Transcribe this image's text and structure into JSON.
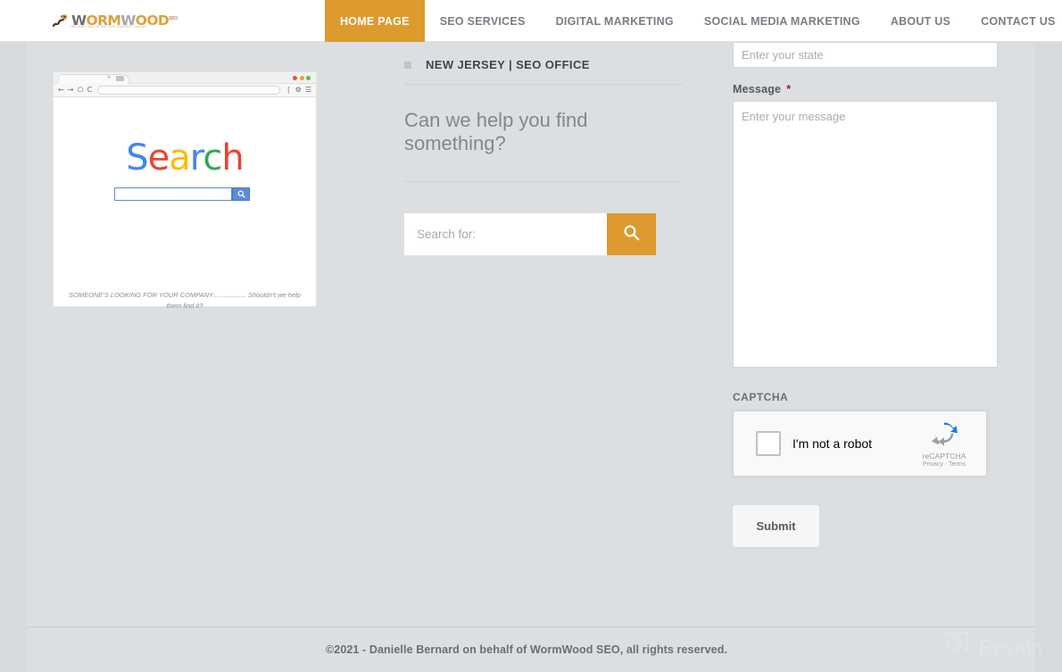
{
  "header": {
    "logo": {
      "name": "WormWood",
      "part1": "W",
      "part2": "ORM",
      "part3": "W",
      "part4": "OOD",
      "superscript": "SEO",
      "tagline": "HELPING YOU BEING DISCOVERED ONLINE",
      "icon": "worm-logo-icon"
    },
    "nav": [
      {
        "label": "HOME PAGE",
        "active": true
      },
      {
        "label": "SEO SERVICES",
        "active": false
      },
      {
        "label": "DIGITAL MARKETING",
        "active": false
      },
      {
        "label": "SOCIAL MEDIA MARKETING",
        "active": false
      },
      {
        "label": "ABOUT US",
        "active": false
      },
      {
        "label": "CONTACT US",
        "active": false
      }
    ],
    "search_icon": "search-icon",
    "active_color": "#dd9a2f",
    "search_button_color": "#1e2c4a"
  },
  "illustration": {
    "browser": {
      "tab_close": "x",
      "url_value": "",
      "back_icon": "arrow-left-icon",
      "forward_icon": "arrow-right-icon",
      "home_icon": "home-icon",
      "reload_icon": "reload-icon",
      "bookmark_icon": "bookmark-icon",
      "settings_icon": "gear-icon",
      "menu_icon": "hamburger-menu-icon",
      "dots": [
        "red",
        "orange",
        "green"
      ]
    },
    "search_word": {
      "letters": [
        "S",
        "e",
        "a",
        "r",
        "c",
        "h"
      ],
      "colors": [
        "#4285f4",
        "#ea4335",
        "#fbbc05",
        "#4285f4",
        "#34a853",
        "#ea4335"
      ]
    },
    "mini_search_icon": "search-icon",
    "caption": "SOMEONE'S LOOKING FOR YOUR COMPANY.................. Shouldn't we help them find it?"
  },
  "middle": {
    "section_title": "NEW JERSEY | SEO OFFICE",
    "heading": "Can we help you find something?",
    "search": {
      "placeholder": "Search for:",
      "value": "",
      "button_icon": "search-icon",
      "button_color": "#dd9a2f"
    }
  },
  "form": {
    "state": {
      "placeholder": "Enter your state",
      "value": ""
    },
    "message": {
      "label": "Message",
      "required_mark": "*",
      "placeholder": "Enter your message",
      "value": ""
    },
    "captcha": {
      "label": "CAPTCHA",
      "checkbox_label": "I'm not a robot",
      "brand": "reCAPTCHA",
      "terms": "Privacy - Terms",
      "checked": false,
      "logo_icon": "recaptcha-icon"
    },
    "submit_label": "Submit"
  },
  "footer": {
    "copyright": "©2021 - Danielle Bernard on behalf of WormWood SEO, all rights reserved."
  },
  "watermark": {
    "text": "Revain",
    "icon": "revain-logo-icon"
  }
}
